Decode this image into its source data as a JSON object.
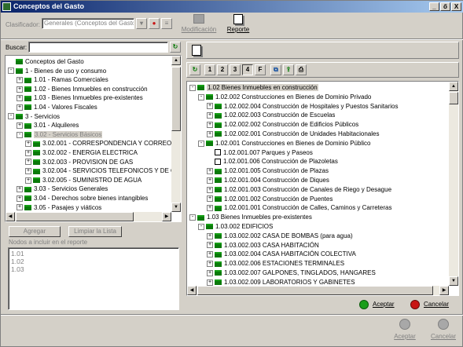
{
  "window": {
    "title": "Conceptos del Gasto",
    "controls": [
      "_",
      "ő",
      "X"
    ]
  },
  "toolbar": {
    "clasificador_label": "Clasificador:",
    "clasificador_value": "Generales (Conceptos del Gasto)",
    "modificacion_label": "Modificación",
    "reporte_label": "Reporte"
  },
  "search": {
    "label": "Buscar:",
    "value": ""
  },
  "left_tree": [
    {
      "label": "Conceptos del Gasto",
      "level": 0,
      "exp": ""
    },
    {
      "label": "1 - Bienes de uso y consumo",
      "level": 0,
      "exp": "-"
    },
    {
      "label": "1.01 - Ramas Comerciales",
      "level": 1,
      "exp": "+"
    },
    {
      "label": "1.02 - Bienes Inmuebles en construcción",
      "level": 1,
      "exp": "+"
    },
    {
      "label": "1.03 - Bienes Inmuebles pre-existentes",
      "level": 1,
      "exp": "+"
    },
    {
      "label": "1.04 - Valores Fiscales",
      "level": 1,
      "exp": "+"
    },
    {
      "label": "3 - Servicios",
      "level": 0,
      "exp": "-"
    },
    {
      "label": "3.01 - Alquileres",
      "level": 1,
      "exp": "+"
    },
    {
      "label": "3.02 - Servicios Básicos",
      "level": 1,
      "exp": "-",
      "selected": true
    },
    {
      "label": "3.02.001 - CORRESPONDENCIA Y CORREO",
      "level": 2,
      "exp": "+"
    },
    {
      "label": "3.02.002 - ENERGIA ELECTRICA",
      "level": 2,
      "exp": "+"
    },
    {
      "label": "3.02.003 - PROVISION DE GAS",
      "level": 2,
      "exp": "+"
    },
    {
      "label": "3.02.004 - SERVICIOS TELEFONICOS Y DE C",
      "level": 2,
      "exp": "+"
    },
    {
      "label": "3.02.005 - SUMINISTRO DE AGUA",
      "level": 2,
      "exp": "+"
    },
    {
      "label": "3.03 - Servicios Generales",
      "level": 1,
      "exp": "+"
    },
    {
      "label": "3.04 - Derechos sobre bienes intangibles",
      "level": 1,
      "exp": "+"
    },
    {
      "label": "3.05 - Pasajes y viáticos",
      "level": 1,
      "exp": "+"
    }
  ],
  "buttons": {
    "agregar": "Agregar",
    "limpiar": "Limpiar la Lista",
    "aceptar": "Aceptar",
    "cancelar": "Cancelar"
  },
  "nodos": {
    "label": "Nodos a incluir en el reporte",
    "items": [
      "1.01",
      "1.02",
      "1.03"
    ]
  },
  "report_toolbar": [
    "1",
    "2",
    "3",
    "4",
    "F"
  ],
  "right_tree": [
    {
      "label": "1.02 Bienes Inmuebles en construcción",
      "level": 0,
      "exp": "-",
      "selected": true,
      "icon": "folder"
    },
    {
      "label": "1.02.002 Construcciones en Bienes de Dominio Privado",
      "level": 1,
      "exp": "-",
      "icon": "folder"
    },
    {
      "label": "1.02.002.004 Construcción de Hospitales y Puestos Sanitarios",
      "level": 2,
      "exp": "+",
      "icon": "folder"
    },
    {
      "label": "1.02.002.003 Construcción de Escuelas",
      "level": 2,
      "exp": "+",
      "icon": "folder"
    },
    {
      "label": "1.02.002.002 Construcción de Edificios Públicos",
      "level": 2,
      "exp": "+",
      "icon": "folder"
    },
    {
      "label": "1.02.002.001 Construcción de Unidades Habitacionales",
      "level": 2,
      "exp": "+",
      "icon": "folder"
    },
    {
      "label": "1.02.001 Construcciones en Bienes de Dominio Público",
      "level": 1,
      "exp": "-",
      "icon": "folder"
    },
    {
      "label": "1.02.001.007 Parques y Paseos",
      "level": 2,
      "exp": "",
      "icon": "doc"
    },
    {
      "label": "1.02.001.006 Construcción de Plazoletas",
      "level": 2,
      "exp": "",
      "icon": "doc"
    },
    {
      "label": "1.02.001.005 Construcción de Plazas",
      "level": 2,
      "exp": "+",
      "icon": "folder"
    },
    {
      "label": "1.02.001.004 Construcción de Diques",
      "level": 2,
      "exp": "+",
      "icon": "folder"
    },
    {
      "label": "1.02.001.003 Construcción de Canales de Riego y Desague",
      "level": 2,
      "exp": "+",
      "icon": "folder"
    },
    {
      "label": "1.02.001.002 Construcción de Puentes",
      "level": 2,
      "exp": "+",
      "icon": "folder"
    },
    {
      "label": "1.02.001.001 Construcción de Calles, Caminos y Carreteras",
      "level": 2,
      "exp": "+",
      "icon": "folder"
    },
    {
      "label": "1.03 Bienes Inmuebles pre-existentes",
      "level": 0,
      "exp": "-",
      "icon": "folder"
    },
    {
      "label": "1.03.002 EDIFICIOS",
      "level": 1,
      "exp": "-",
      "icon": "folder"
    },
    {
      "label": "1.03.002.002 CASA DE BOMBAS (para agua)",
      "level": 2,
      "exp": "+",
      "icon": "folder"
    },
    {
      "label": "1.03.002.003 CASA HABITACIÓN",
      "level": 2,
      "exp": "+",
      "icon": "folder"
    },
    {
      "label": "1.03.002.004 CASA HABITACIÓN COLECTIVA",
      "level": 2,
      "exp": "+",
      "icon": "folder"
    },
    {
      "label": "1.03.002.006 ESTACIONES TERMINALES",
      "level": 2,
      "exp": "+",
      "icon": "folder"
    },
    {
      "label": "1.03.002.007 GALPONES, TINGLADOS, HANGARES",
      "level": 2,
      "exp": "+",
      "icon": "folder"
    },
    {
      "label": "1.03.002.009 LABORATORIOS Y GABINETES",
      "level": 2,
      "exp": "+",
      "icon": "folder"
    }
  ],
  "colors": {
    "accept": "#1a9e1a",
    "cancel": "#c81414",
    "folder": "#0a7a0a",
    "title": "#0a246a"
  }
}
